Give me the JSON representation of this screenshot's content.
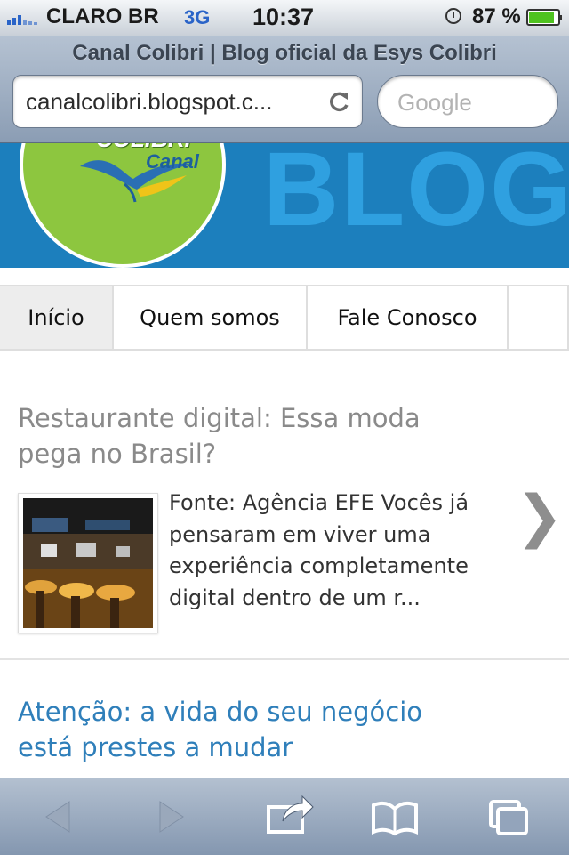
{
  "status_bar": {
    "carrier": "CLARO BR",
    "network": "3G",
    "time": "10:37",
    "battery": "87 %",
    "battery_level": 0.87,
    "signal_icon": "signal-bars-icon",
    "network_color": "#2a64c8"
  },
  "browser": {
    "page_title": "Canal Colibri | Blog oficial da Esys Colibri",
    "url": "canalcolibri.blogspot.c...",
    "search_placeholder": "Google"
  },
  "banner": {
    "logo_brand": "COLIBRI",
    "logo_sub": "Canal",
    "word": "BLOG",
    "bg_color": "#1c7fbd",
    "logo_color": "#8dc63f"
  },
  "nav": {
    "tabs": [
      {
        "label": "Início",
        "active": true
      },
      {
        "label": "Quem somos"
      },
      {
        "label": "Fale Conosco"
      }
    ]
  },
  "posts": [
    {
      "title": "Restaurante digital: Essa moda pega no Brasil?",
      "excerpt": "Fonte: Agência EFE Vocês já pensaram em viver uma experiência completamente digital dentro de um r..."
    },
    {
      "title": "Atenção: a vida do seu negócio está prestes a mudar"
    }
  ],
  "toolbar": {
    "icons": [
      "back-icon",
      "forward-icon",
      "share-icon",
      "bookmarks-icon",
      "pages-icon"
    ]
  }
}
